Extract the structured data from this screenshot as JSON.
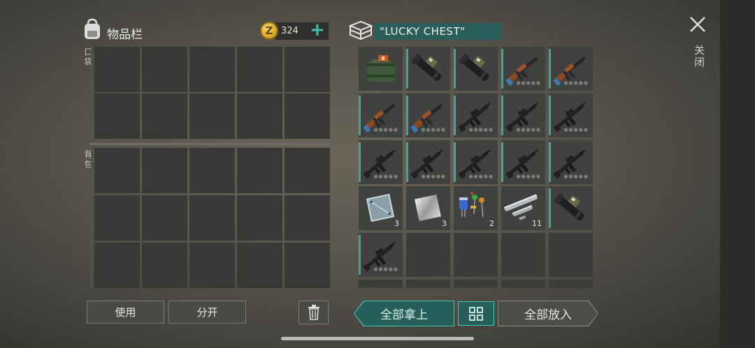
{
  "inventory": {
    "title": "物品栏",
    "coins": "324",
    "pocket_label": "口袋",
    "backpack_label": "背包"
  },
  "chest": {
    "name": "\"LUCKY CHEST\"",
    "items": [
      {
        "type": "medkit",
        "qty": ""
      },
      {
        "type": "launcher",
        "qty": ""
      },
      {
        "type": "launcher",
        "qty": ""
      },
      {
        "type": "ak",
        "qty": ""
      },
      {
        "type": "ak",
        "qty": ""
      },
      {
        "type": "ak",
        "qty": ""
      },
      {
        "type": "ak",
        "qty": ""
      },
      {
        "type": "m16",
        "qty": ""
      },
      {
        "type": "m16",
        "qty": ""
      },
      {
        "type": "m16",
        "qty": ""
      },
      {
        "type": "m16",
        "qty": ""
      },
      {
        "type": "m16",
        "qty": ""
      },
      {
        "type": "m16",
        "qty": ""
      },
      {
        "type": "m16",
        "qty": ""
      },
      {
        "type": "m16",
        "qty": ""
      },
      {
        "type": "glass",
        "qty": "3"
      },
      {
        "type": "metal",
        "qty": "3"
      },
      {
        "type": "electronics",
        "qty": "2"
      },
      {
        "type": "pipes",
        "qty": "11"
      },
      {
        "type": "launcher",
        "qty": ""
      },
      {
        "type": "m16",
        "qty": ""
      }
    ]
  },
  "buttons": {
    "use": "使用",
    "split": "分开",
    "take_all": "全部拿上",
    "put_all": "全部放入",
    "close": "关闭"
  },
  "colors": {
    "accent": "#3fbfa8",
    "chest_header": "#2a5e5a"
  }
}
